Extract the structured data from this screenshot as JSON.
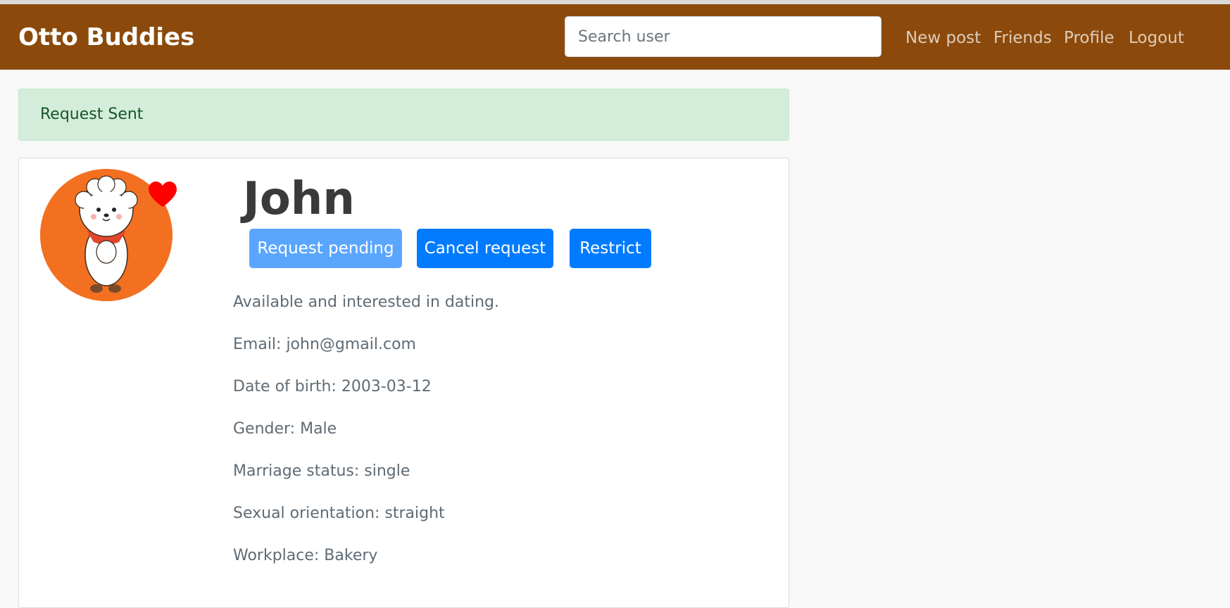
{
  "navbar": {
    "brand": "Otto Buddies",
    "search_placeholder": "Search user",
    "links": [
      "New post",
      "Friends",
      "Profile",
      "Logout"
    ]
  },
  "alert": {
    "message": "Request Sent"
  },
  "profile": {
    "name": "John",
    "buttons": {
      "pending": "Request pending",
      "cancel": "Cancel request",
      "restrict": "Restrict"
    },
    "bio": "Available and interested in dating.",
    "details": [
      "Email: john@gmail.com",
      "Date of birth: 2003-03-12",
      "Gender: Male",
      "Marriage status: single",
      "Sexual orientation: straight",
      "Workplace: Bakery"
    ],
    "avatar_icon": "sheep-character-avatar",
    "heart_icon": "heart-icon"
  },
  "colors": {
    "navbar": "#8b4a0b",
    "alert_bg": "#d4edda",
    "alert_text": "#155724",
    "primary": "#007bff",
    "pending": "#5aa6ff",
    "avatar_bg": "#f37021",
    "heart": "#ff0000"
  }
}
